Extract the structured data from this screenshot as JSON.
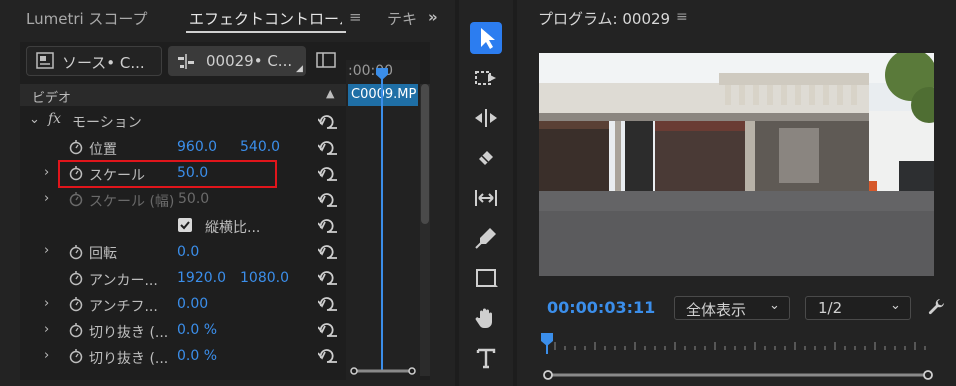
{
  "left_panel": {
    "tabs": [
      {
        "label": "Lumetri スコープ"
      },
      {
        "label": "エフェクトコントロール"
      },
      {
        "label": "テキ"
      }
    ],
    "overflow_icon": "chevron-double-right-icon",
    "source_button": {
      "label": "ソース• C..."
    },
    "sequence_button": {
      "label": "00029• C..."
    },
    "section_header": "ビデオ",
    "rows": [
      {
        "label": "モーション",
        "fx": "fx"
      },
      {
        "label": "位置",
        "v1": "960.0",
        "v2": "540.0"
      },
      {
        "label": "スケール",
        "v1": "50.0"
      },
      {
        "label": "スケール (幅)",
        "v1": "50.0"
      },
      {
        "label": "縦横比..."
      },
      {
        "label": "回転",
        "v1": "0.0"
      },
      {
        "label": "アンカー...",
        "v1": "1920.0",
        "v2": "1080.0"
      },
      {
        "label": "アンチフ...",
        "v1": "0.00"
      },
      {
        "label": "切り抜き (...",
        "v1": "0.0 %"
      },
      {
        "label": "切り抜き (...",
        "v1": "0.0 %"
      }
    ],
    "timeline": {
      "time": ":00:00",
      "clip_label": "C0009.MP"
    }
  },
  "toolbar": {
    "tools": [
      "selection-tool-icon",
      "track-select-icon",
      "ripple-edit-icon",
      "razor-icon",
      "slip-icon",
      "pen-icon",
      "rectangle-icon",
      "hand-icon",
      "type-icon"
    ]
  },
  "program_monitor": {
    "title": "プログラム: 00029",
    "timecode": "00:00:03:11",
    "zoom_select": "全体表示",
    "resolution_select": "1/2"
  },
  "colors": {
    "accent": "#3b8eea",
    "highlight": "#e0151b",
    "selected_tool": "#2c7df0"
  }
}
